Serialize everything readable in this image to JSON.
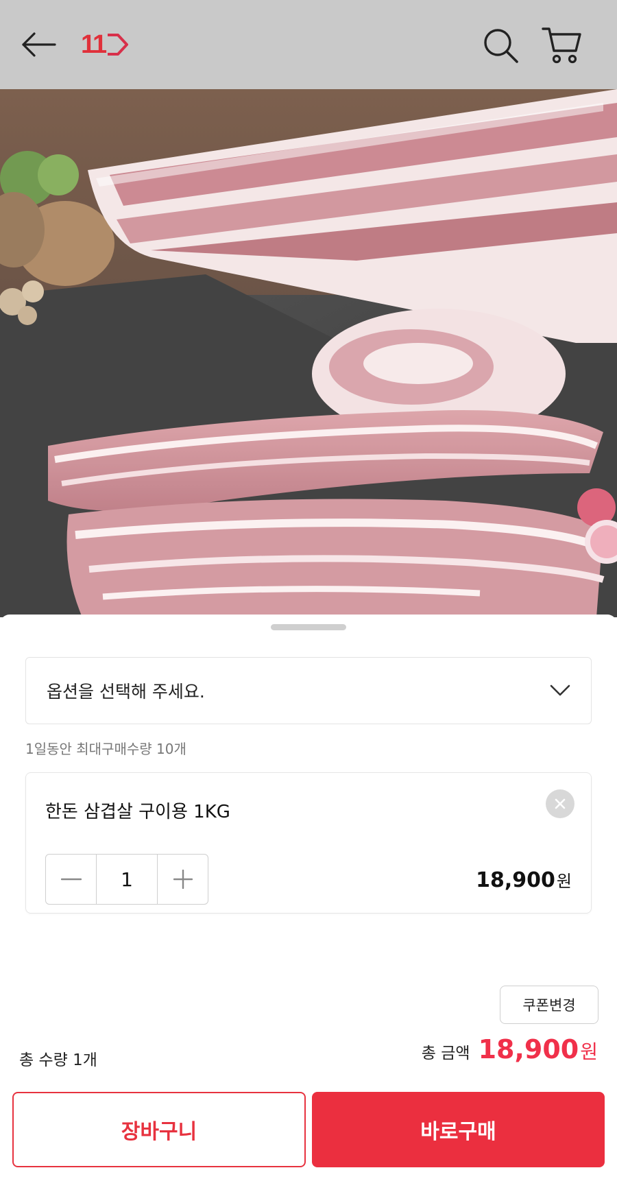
{
  "header": {
    "logo_text": "11",
    "back_icon": "arrow-left-icon",
    "search_icon": "search-icon",
    "cart_icon": "cart-icon",
    "bg_color": "#c9c9c9",
    "brand_color": "#e0303a"
  },
  "hero": {
    "image": "product-photo-pork-belly"
  },
  "sheet": {
    "option_placeholder": "옵션을 선택해 주세요.",
    "max_qty_note": "1일동안 최대구매수량 10개",
    "selected_item": {
      "name": "한돈 삼겹살 구이용 1KG",
      "quantity": "1",
      "price": "18,900",
      "price_unit": "원"
    },
    "coupon_label": "쿠폰변경",
    "total_qty": "총 수량 1개",
    "total_amount_label": "총 금액",
    "total_amount": "18,900",
    "total_amount_unit": "원",
    "add_to_cart_label": "장바구니",
    "buy_now_label": "바로구매",
    "accent_color": "#eb2f3f"
  }
}
